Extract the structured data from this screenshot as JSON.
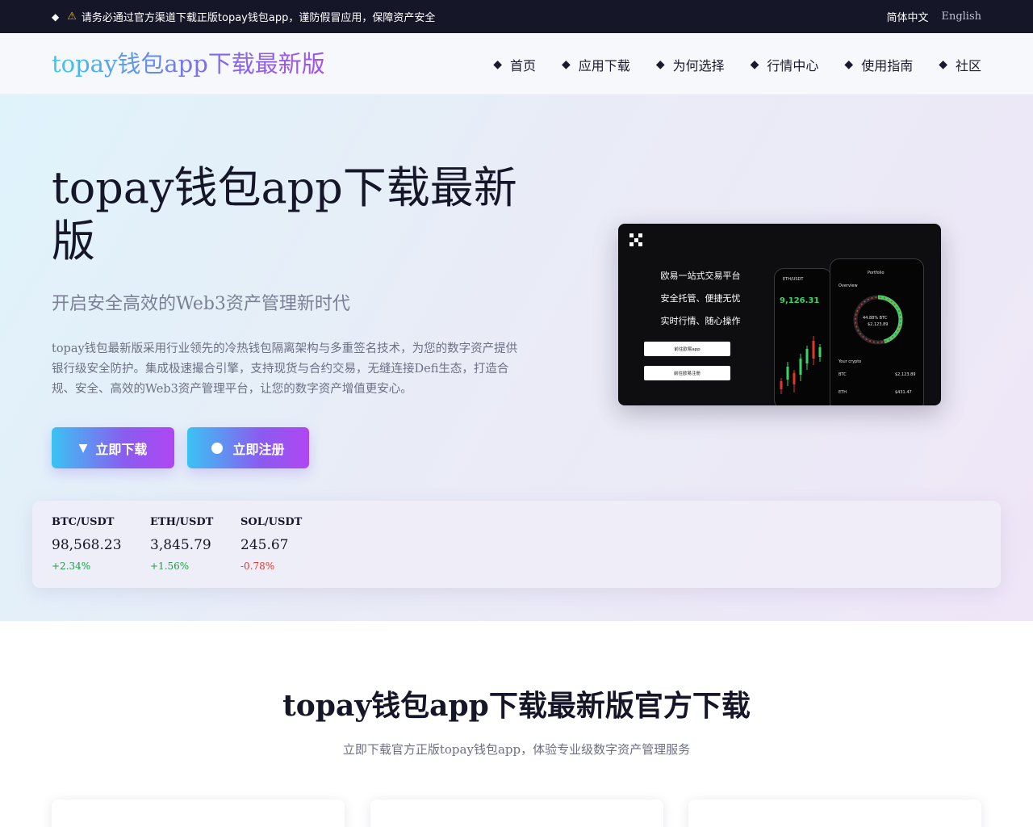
{
  "topbar": {
    "notice_icon": "diamond-icon",
    "warning_icon": "warning-icon",
    "notice": "请务必通过官方渠道下载正版topay钱包app，谨防假冒应用，保障资产安全",
    "lang_zh": "简体中文",
    "lang_en": "English"
  },
  "header": {
    "logo": "topay钱包app下载最新版",
    "nav": [
      "首页",
      "应用下载",
      "为何选择",
      "行情中心",
      "使用指南",
      "社区"
    ]
  },
  "hero": {
    "title": "topay钱包app下载最新版",
    "subtitle": "开启安全高效的Web3资产管理新时代",
    "description": "topay钱包最新版采用行业领先的冷热钱包隔离架构与多重签名技术，为您的数字资产提供银行级安全防护。集成极速撮合引擎，支持现货与合约交易，无缝连接Defi生态，打造合规、安全、高效的Web3资产管理平台，让您的数字资产增值更安心。",
    "download_button": "立即下载",
    "register_button": "立即注册",
    "promo": {
      "line1": "欧易一站式交易平台",
      "line2": "安全托管、便捷无忧",
      "line3": "实时行情、随心操作",
      "button1": "前往欧易app",
      "button2": "前往欧易注册",
      "phone_a_pair": "ETH/USDT",
      "phone_a_price": "9,126.31",
      "phone_b_title": "Portfolio",
      "phone_b_overview": "Overview",
      "phone_b_ring": "44.88% BTC",
      "phone_b_ring_value": "$2,123.89",
      "phone_b_your_crypto": "Your crypto",
      "phone_b_row1_coin": "BTC",
      "phone_b_row1_value": "$2,123.89",
      "phone_b_row2_coin": "ETH",
      "phone_b_row2_value": "$431.47"
    }
  },
  "ticker": [
    {
      "pair": "BTC/USDT",
      "price": "98,568.23",
      "change": "+2.34%",
      "direction": "up"
    },
    {
      "pair": "ETH/USDT",
      "price": "3,845.79",
      "change": "+1.56%",
      "direction": "up"
    },
    {
      "pair": "SOL/USDT",
      "price": "245.67",
      "change": "-0.78%",
      "direction": "down"
    }
  ],
  "download_section": {
    "title": "topay钱包app下载最新版官方下载",
    "subtitle": "立即下载官方正版topay钱包app，体验专业级数字资产管理服务"
  },
  "colors": {
    "topbar_bg": "#161629",
    "accent_start": "#39c8f0",
    "accent_end": "#a34fee",
    "up": "#1f9d44",
    "down": "#e0382f"
  }
}
